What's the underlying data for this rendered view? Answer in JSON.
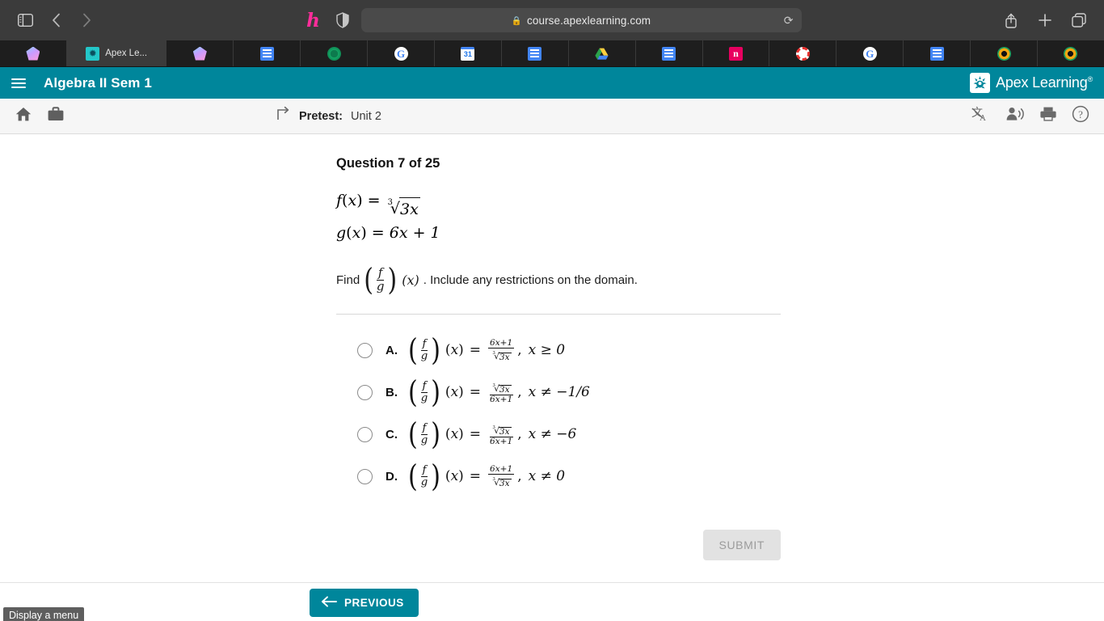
{
  "browser": {
    "sidebar_toggle_icon": "sidebar-toggle-icon",
    "back_icon": "‹",
    "forward_icon": "›",
    "honey_ext_icon": "h",
    "shield_ext_icon": "shield-icon",
    "url": "course.apexlearning.com",
    "lock_icon": "🔒",
    "reload_icon": "⟳",
    "share_icon": "share-icon",
    "new_tab_icon": "+",
    "tabs_overview_icon": "tabs-overview-icon",
    "tabs": [
      {
        "title": "",
        "favicon": "fav-diamond",
        "active": false
      },
      {
        "title": "Apex Le...",
        "favicon": "fav-apex",
        "active": true
      },
      {
        "title": "",
        "favicon": "fav-diamond",
        "active": false
      },
      {
        "title": "",
        "favicon": "fav-docs",
        "active": false
      },
      {
        "title": "",
        "favicon": "fav-green",
        "active": false
      },
      {
        "title": "",
        "favicon": "fav-google",
        "active": false
      },
      {
        "title": "",
        "favicon": "fav-cal",
        "active": false
      },
      {
        "title": "",
        "favicon": "fav-docs",
        "active": false
      },
      {
        "title": "",
        "favicon": "fav-drive",
        "active": false
      },
      {
        "title": "",
        "favicon": "fav-docs",
        "active": false
      },
      {
        "title": "",
        "favicon": "fav-n",
        "active": false
      },
      {
        "title": "",
        "favicon": "fav-red-o",
        "active": false
      },
      {
        "title": "",
        "favicon": "fav-google",
        "active": false
      },
      {
        "title": "",
        "favicon": "fav-docs",
        "active": false
      },
      {
        "title": "",
        "favicon": "fav-ring",
        "active": false
      },
      {
        "title": "",
        "favicon": "fav-ring",
        "active": false
      }
    ]
  },
  "app_header": {
    "menu_icon": "hamburger-icon",
    "course_title": "Algebra II Sem 1",
    "brand_name": "Apex Learning",
    "brand_tm": "®",
    "brand_color": "#00869b"
  },
  "subbar": {
    "home_icon": "home-icon",
    "briefcase_icon": "briefcase-icon",
    "up_arrow_icon": "up-level-icon",
    "crumb_label": "Pretest:",
    "crumb_value": "Unit 2",
    "translate_icon": "translate-icon",
    "read_aloud_icon": "read-aloud-icon",
    "print_icon": "print-icon",
    "help_icon": "help-icon"
  },
  "question": {
    "heading": "Question 7 of 25",
    "fx_label": "f",
    "gx_label": "g",
    "fx_body": "3x",
    "radical_index": "3",
    "gx_body": "6x + 1",
    "prompt_prefix": "Find",
    "prompt_suffix": ". Include any restrictions on the domain.",
    "prompt_numerator": "f",
    "prompt_denominator": "g",
    "prompt_arg": "(x)",
    "options": [
      {
        "letter": "A.",
        "numerator": "6x+1",
        "denominator": "radical:3x",
        "restriction": "x ≥ 0",
        "selected": false
      },
      {
        "letter": "B.",
        "numerator": "radical:3x",
        "denominator": "6x+1",
        "restriction": "x ≠ −1/6",
        "selected": false
      },
      {
        "letter": "C.",
        "numerator": "radical:3x",
        "denominator": "6x+1",
        "restriction": "x ≠ −6",
        "selected": false
      },
      {
        "letter": "D.",
        "numerator": "6x+1",
        "denominator": "radical:3x",
        "restriction": "x ≠ 0",
        "selected": false
      }
    ],
    "submit_label": "SUBMIT"
  },
  "footer": {
    "previous_label": "PREVIOUS",
    "previous_arrow_icon": "arrow-left-icon",
    "tooltip": "Display a menu"
  }
}
